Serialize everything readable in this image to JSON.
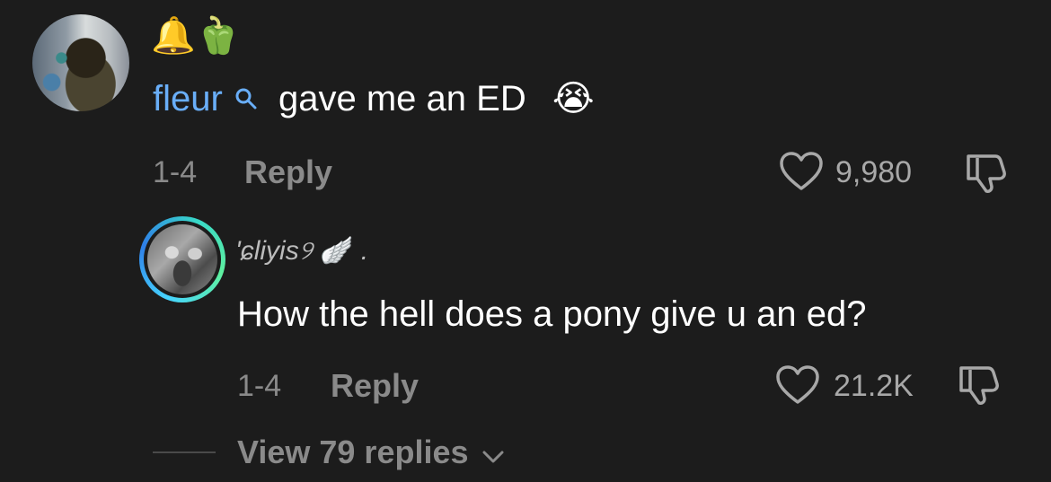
{
  "comment": {
    "emoji_row": "🔔🫑",
    "username": "fleur",
    "text": "gave me an ED",
    "text_emoji": "😭",
    "date": "1-4",
    "reply_label": "Reply",
    "like_count": "9,980"
  },
  "reply": {
    "username": "'ɕliyis",
    "username_suffix": "୨",
    "username_emoji": "🪽",
    "username_trail": ".",
    "text": "How the hell does a pony give u an ed?",
    "date": "1-4",
    "reply_label": "Reply",
    "like_count": "21.2K"
  },
  "view_replies_label": "View 79 replies",
  "colors": {
    "background": "#1c1c1c",
    "username_link": "#69aef8",
    "muted": "#8a8a8a",
    "avatar_ring": [
      "#46d4ff",
      "#2f7fe8",
      "#5ef0a0"
    ]
  },
  "icons": [
    "heart-icon",
    "dislike-icon",
    "search-verify-icon",
    "chevron-down-icon"
  ]
}
